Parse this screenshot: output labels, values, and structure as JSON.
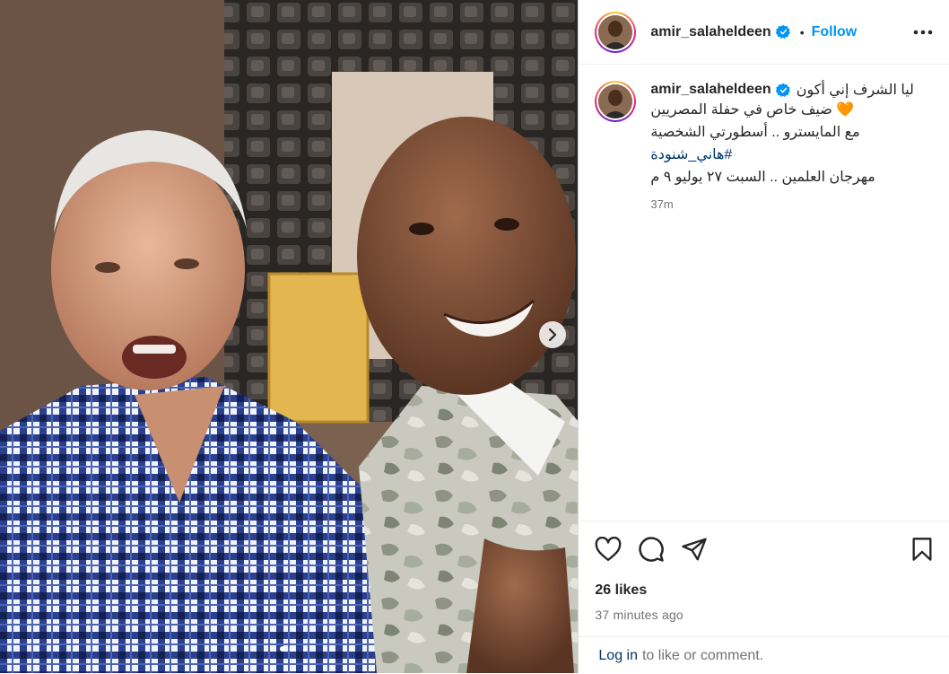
{
  "post": {
    "username": "amir_salaheldeen",
    "follow_label": "Follow",
    "bullet": "•",
    "caption": {
      "line1": "ليا الشرف إني أكون",
      "line2": "ضيف خاص في حفلة المصريين",
      "heart_emoji": "🧡",
      "line3": "مع المايسترو .. أسطورتي الشخصية",
      "hashtag": "#هاني_شنودة",
      "line5": "مهرجان العلمين .. السبت ٢٧ يوليو ٩ م",
      "time": "37m"
    },
    "likes": "26 likes",
    "posted_ago": "37 minutes ago",
    "login": {
      "link": "Log in",
      "text": "to like or comment."
    }
  },
  "icons": {
    "verified": "verified-badge-icon",
    "more": "more-options-icon",
    "like": "heart-icon",
    "comment": "comment-icon",
    "share": "share-icon",
    "save": "bookmark-icon",
    "next": "chevron-right-icon"
  },
  "colors": {
    "accent": "#0095f6",
    "link": "#00376b",
    "muted": "#737373",
    "text": "#262626"
  },
  "carousel": {
    "slides": 2,
    "active": 1
  }
}
